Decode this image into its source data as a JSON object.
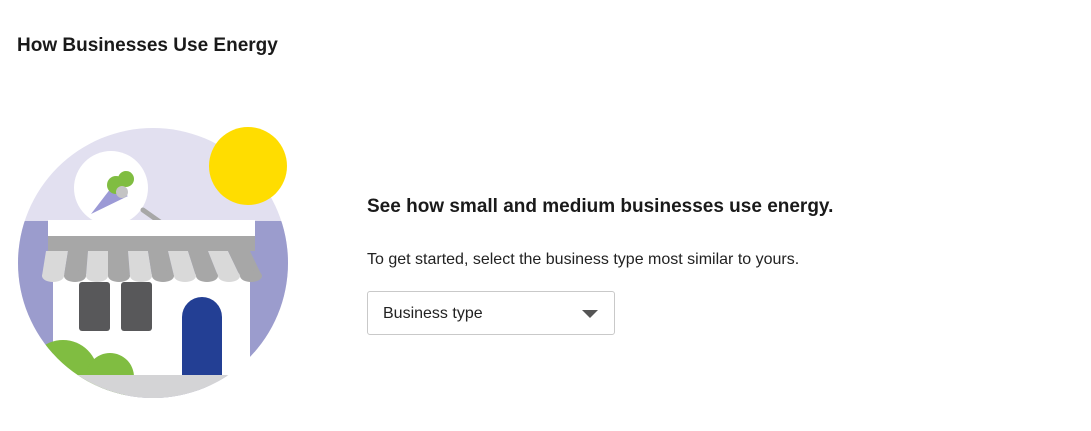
{
  "page": {
    "title": "How Businesses Use Energy"
  },
  "intro": {
    "headline": "See how small and medium businesses use energy.",
    "instructions": "To get started, select the business type most similar to yours."
  },
  "business_select": {
    "selected_label": "Business type"
  },
  "illustration": {
    "icon": "storefront-icon",
    "colors": {
      "sky": "#e2e0f0",
      "ground": "#9b9ccd",
      "sun": "#ffdd00",
      "awning_light": "#d9d9d9",
      "awning_dark": "#a7a7a7",
      "window": "#58585a",
      "door": "#233f94",
      "bush": "#80bd41",
      "sidewalk": "#d4d4d6",
      "cone": "#9c9ad6"
    }
  }
}
